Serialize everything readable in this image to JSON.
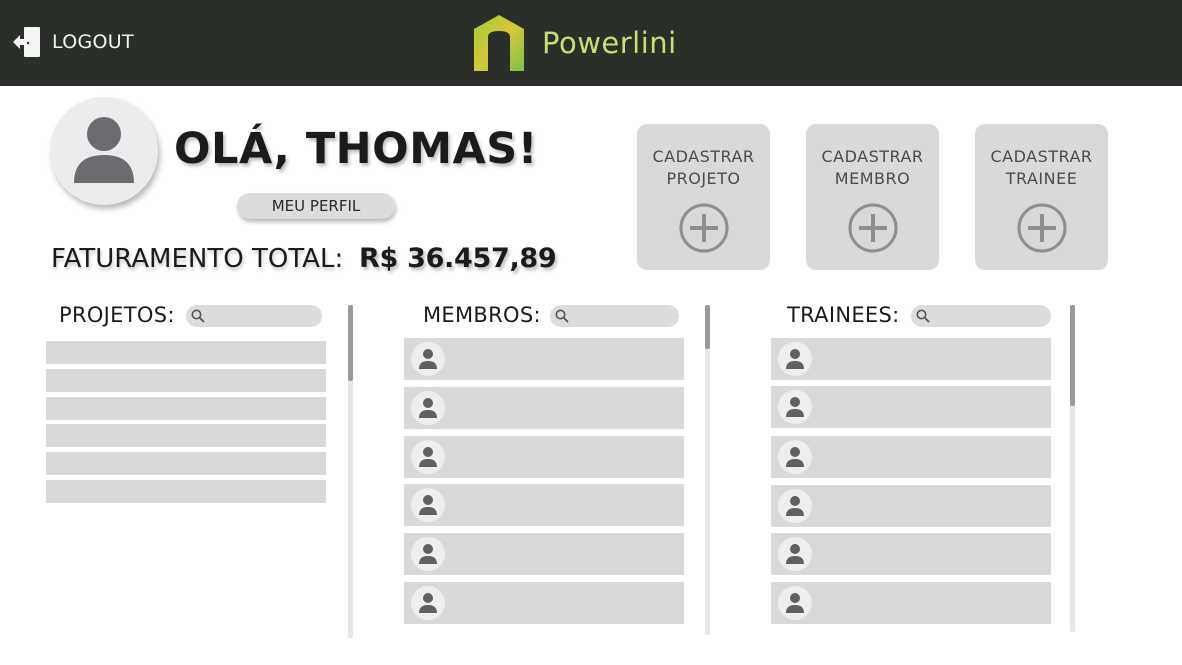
{
  "header": {
    "logout_label": "LOGOUT",
    "brand_name": "Powerlini",
    "bg_color": "#2b2f29",
    "brand_color": "#c9de72"
  },
  "profile": {
    "greeting": "OLÁ, THOMAS!",
    "profile_button": "MEU PERFIL",
    "revenue_label": "FATURAMENTO TOTAL:",
    "revenue_value": "R$ 36.457,89"
  },
  "actions": [
    {
      "label": "CADASTRAR\nPROJETO",
      "icon": "plus-circle-icon"
    },
    {
      "label": "CADASTRAR\nMEMBRO",
      "icon": "plus-circle-icon"
    },
    {
      "label": "CADASTRAR\nTRAINEE",
      "icon": "plus-circle-icon"
    }
  ],
  "projects": {
    "title": "PROJETOS:",
    "search_placeholder": "",
    "row_count": 6,
    "scroll_fraction_visible": 0.22
  },
  "members": {
    "title": "MEMBROS:",
    "search_placeholder": "",
    "row_count": 6,
    "scroll_fraction_visible": 0.13
  },
  "trainees": {
    "title": "TRAINEES:",
    "search_placeholder": "",
    "row_count": 6,
    "scroll_fraction_visible": 0.31
  }
}
